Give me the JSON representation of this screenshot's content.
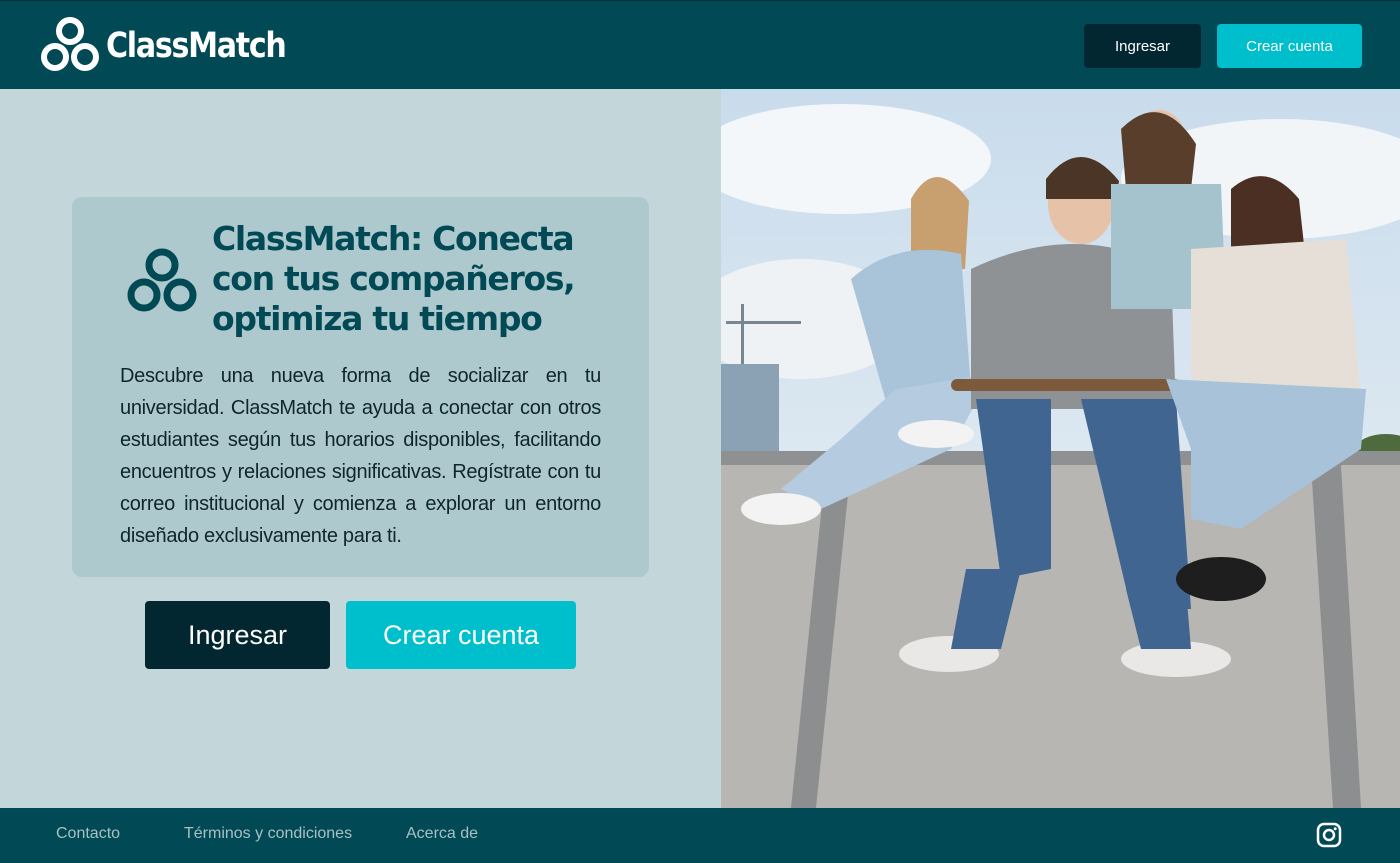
{
  "header": {
    "brand": "ClassMatch",
    "login_label": "Ingresar",
    "signup_label": "Crear cuenta"
  },
  "hero": {
    "title": "ClassMatch: Conecta con tus compañeros, optimiza tu tiempo",
    "description": "Descubre una nueva forma de socializar en tu universidad. ClassMatch te ayuda a conectar con otros estudiantes según tus horarios disponibles, facilitando encuentros y relaciones significativas. Regístrate con tu correo institucional y comienza a explorar un entorno diseñado exclusivamente para ti.",
    "login_label": "Ingresar",
    "signup_label": "Crear cuenta"
  },
  "photo": {
    "subject": "group-of-four-students-sitting-on-skatepark-ramp"
  },
  "footer": {
    "links": [
      "Contacto",
      "Términos y condiciones",
      "Acerca de"
    ],
    "social_icon": "instagram-icon"
  },
  "colors": {
    "header_bg": "#004955",
    "page_bg": "#c3d6da",
    "card_bg": "#aec9cd",
    "primary_dark": "#022730",
    "accent": "#00bfcc",
    "title_color": "#004955"
  }
}
